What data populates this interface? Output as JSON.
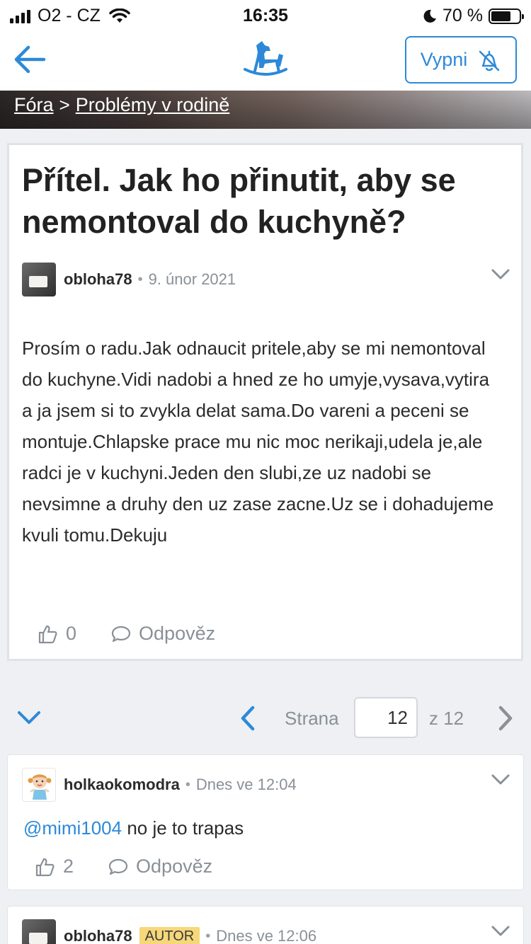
{
  "status": {
    "carrier": "O2 - CZ",
    "time": "16:35",
    "battery": "70 %",
    "battery_level": 0.7
  },
  "header": {
    "mute_label": "Vypni"
  },
  "breadcrumb": {
    "root": "Fóra",
    "separator": ">",
    "current": "Problémy v rodině"
  },
  "post": {
    "title": "Přítel. Jak ho přinutit, aby se nemontoval do kuchyně?",
    "author": "obloha78",
    "date": "9. únor 2021",
    "body": "Prosím o radu.Jak odnaucit pritele,aby se mi nemontoval do kuchyne.Vidi nadobi a hned ze ho umyje,vysava,vytira a ja jsem si to zvykla delat sama.Do vareni a peceni se montuje.Chlapske prace mu nic moc nerikaji,udela je,ale radci je v kuchyni.Jeden den slubi,ze uz nadobi se nevsimne a druhy den uz zase zacne.Uz se i dohadujeme kvuli tomu.Dekuju",
    "likes": "0",
    "reply_label": "Odpověz"
  },
  "pager": {
    "label": "Strana",
    "current_page": "12",
    "of_text": "z  12"
  },
  "comments": [
    {
      "author": "holkaokomodra",
      "time": "Dnes ve 12:04",
      "mention": "@mimi1004",
      "text": " no je to trapas",
      "likes": "2",
      "reply_label": "Odpověz"
    },
    {
      "author": "obloha78",
      "badge": "AUTOR",
      "time": "Dnes ve 12:06"
    }
  ]
}
